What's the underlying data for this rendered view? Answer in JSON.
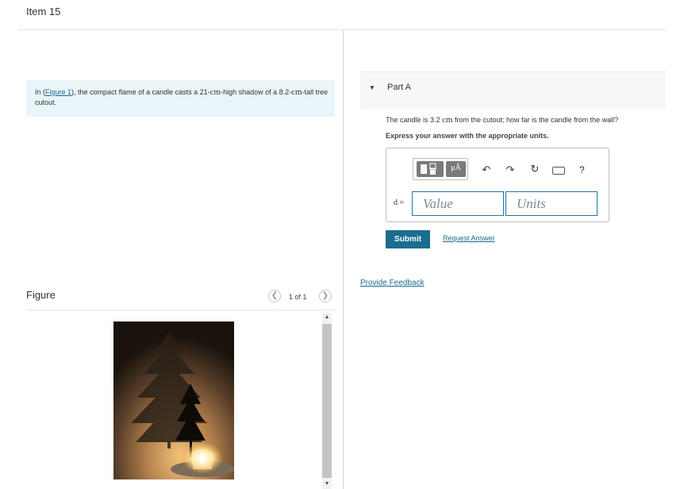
{
  "header": {
    "item_title": "Item 15"
  },
  "problem": {
    "text_before": "In (",
    "figure_link": "Figure 1",
    "text_middle": "), the compact flame of a candle casts a 21-",
    "unit1": "cm",
    "text_after": "-high shadow of a 8.2-",
    "unit2": "cm",
    "text_end": "-tall tree cutout."
  },
  "figure": {
    "label": "Figure",
    "page_count": "1 of 1",
    "prev_icon": "chevron-left-icon",
    "next_icon": "chevron-right-icon"
  },
  "part": {
    "title": "Part A",
    "question_before": "The candle is 3.2 ",
    "question_unit": "cm",
    "question_after": " from the cutout; how far is the candle from the wall?",
    "instruction": "Express your answer with the appropriate units."
  },
  "toolbar": {
    "units_label": "μÅ",
    "undo_icon": "undo-icon",
    "redo_icon": "redo-icon",
    "reset_icon": "reset-icon",
    "keyboard_icon": "keyboard-icon",
    "help_label": "?"
  },
  "answer": {
    "variable": "d =",
    "value_placeholder": "Value",
    "units_placeholder": "Units"
  },
  "actions": {
    "submit_label": "Submit",
    "request_answer": "Request Answer",
    "provide_feedback": "Provide Feedback"
  },
  "colors": {
    "accent": "#1a6d8f",
    "link": "#1a6a8c",
    "problem_bg": "#e9f5f8"
  }
}
